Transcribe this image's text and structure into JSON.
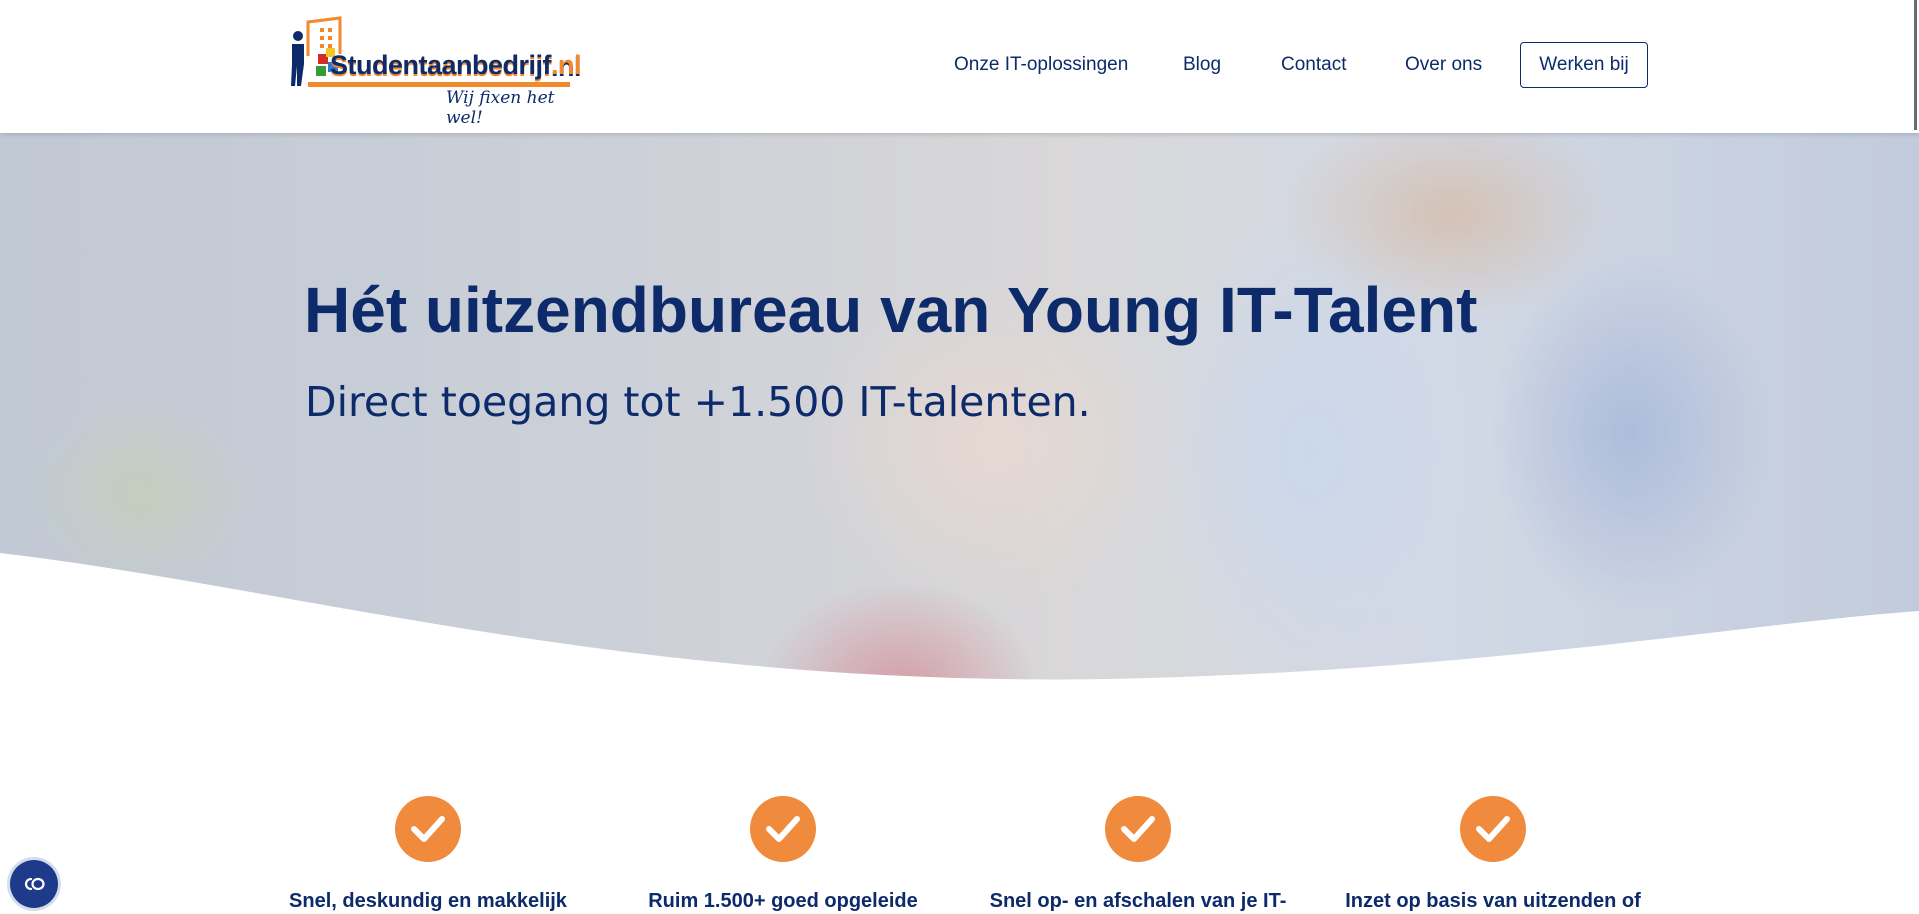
{
  "header": {
    "logo_text_main": "Studentaanbedrijf",
    "logo_text_tld": ".nl",
    "logo_tagline": "Wij fixen het wel!",
    "nav": [
      {
        "label": "Onze IT-oplossingen"
      },
      {
        "label": "Blog"
      },
      {
        "label": "Contact"
      },
      {
        "label": "Over ons"
      }
    ],
    "cta_label": "Werken bij"
  },
  "hero": {
    "title": "Hét uitzendbureau van Young IT-Talent",
    "subtitle": "Direct toegang tot +1.500 IT-talenten."
  },
  "features": [
    {
      "icon": "check-icon",
      "label": "Snel, deskundig en makkelijk"
    },
    {
      "icon": "check-icon",
      "label": "Ruim 1.500+ goed opgeleide"
    },
    {
      "icon": "check-icon",
      "label": "Snel op- en afschalen van je IT-"
    },
    {
      "icon": "check-icon",
      "label": "Inzet op basis van uitzenden of"
    }
  ],
  "accessibility": {
    "icon": "accessibility-icon"
  },
  "colors": {
    "brand_navy": "#0d2b6b",
    "brand_orange": "#f08a3c",
    "accessibility_blue": "#1e3a8a"
  }
}
